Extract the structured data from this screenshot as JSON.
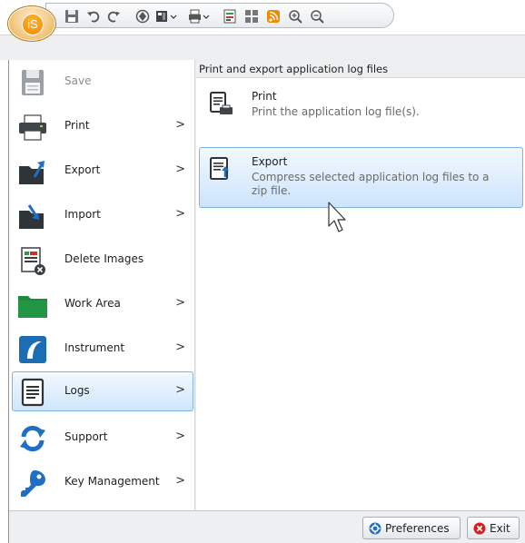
{
  "app": {
    "orb_label": "iS"
  },
  "quick_access": {
    "icons": [
      "save-icon",
      "undo-icon",
      "redo-icon",
      "settings-icon",
      "view-icon",
      "print-icon",
      "export-icon",
      "grid-icon",
      "rss-icon",
      "zoom-in-icon",
      "zoom-out-icon"
    ]
  },
  "left_menu": {
    "items": [
      {
        "label": "Save",
        "icon": "save-icon",
        "enabled": false,
        "has_submenu": false
      },
      {
        "label": "Print",
        "icon": "printer-icon",
        "enabled": true,
        "has_submenu": true
      },
      {
        "label": "Export",
        "icon": "export-folder-icon",
        "enabled": true,
        "has_submenu": true
      },
      {
        "label": "Import",
        "icon": "import-folder-icon",
        "enabled": true,
        "has_submenu": true
      },
      {
        "label": "Delete Images",
        "icon": "delete-images-icon",
        "enabled": true,
        "has_submenu": false
      },
      {
        "label": "Work Area",
        "icon": "folder-icon",
        "enabled": true,
        "has_submenu": true
      },
      {
        "label": "Instrument",
        "icon": "instrument-icon",
        "enabled": true,
        "has_submenu": true
      },
      {
        "label": "Logs",
        "icon": "log-document-icon",
        "enabled": true,
        "has_submenu": true,
        "selected": true
      },
      {
        "label": "Support",
        "icon": "support-sync-icon",
        "enabled": true,
        "has_submenu": true
      },
      {
        "label": "Key Management",
        "icon": "key-icon",
        "enabled": true,
        "has_submenu": true
      }
    ],
    "chevron": ">"
  },
  "right_panel": {
    "header": "Print and export application log files",
    "items": [
      {
        "title": "Print",
        "description": "Print the application log file(s).",
        "icon": "print-log-icon"
      },
      {
        "title": "Export",
        "description": "Compress selected application log files to a zip file.",
        "icon": "export-log-icon",
        "selected": true
      }
    ]
  },
  "footer": {
    "preferences_label": "Preferences",
    "exit_label": "Exit"
  },
  "colors": {
    "accent_orange": "#f08a00",
    "selection_border": "#7fb2e3",
    "selection_fill": "#cfe6fb",
    "folder_green": "#1e8a3c",
    "instrument_blue": "#1d6db5",
    "support_blue": "#1f6fc4",
    "exit_red": "#d42020"
  }
}
